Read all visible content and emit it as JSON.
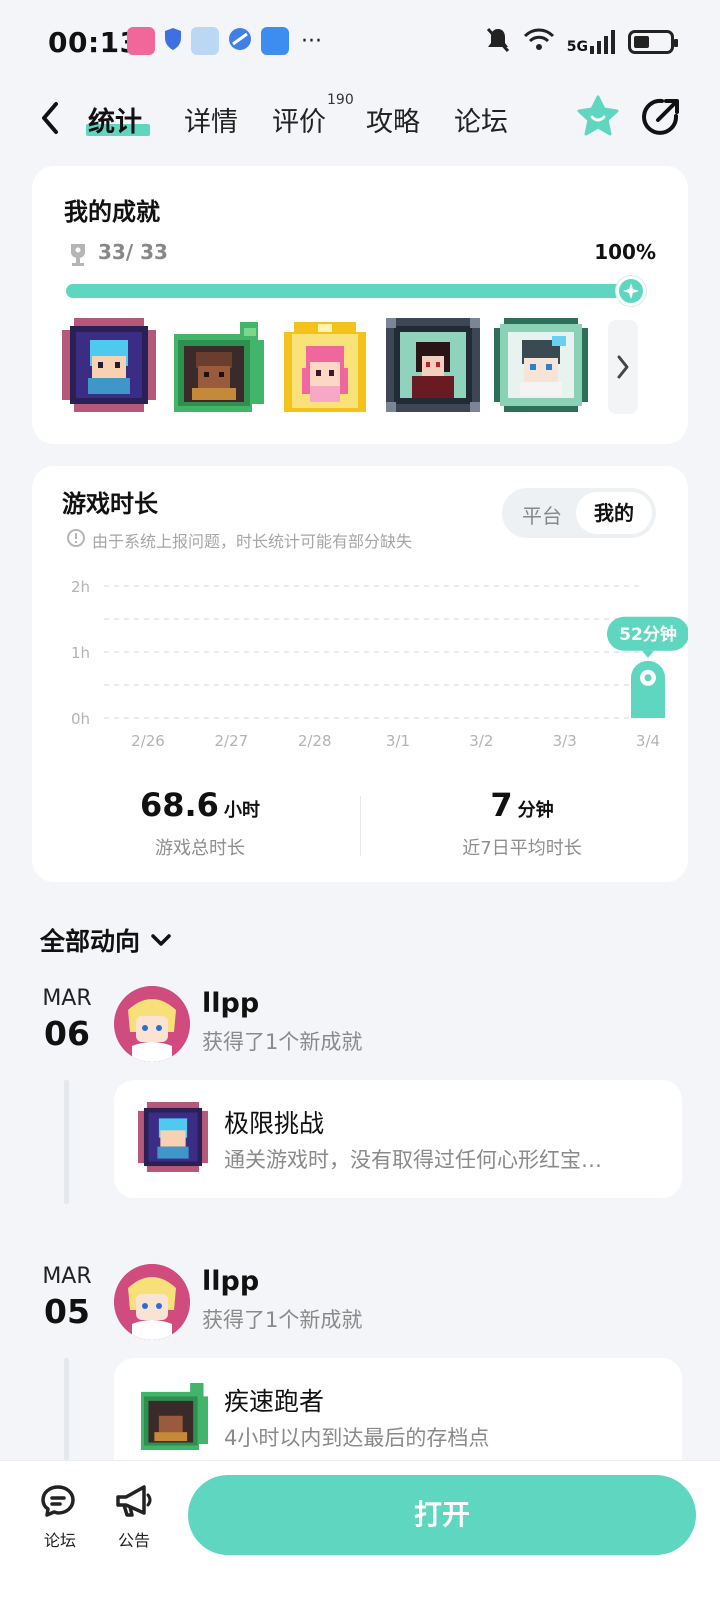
{
  "status_bar": {
    "time": "00:13",
    "network": "5G",
    "battery_level": 0.45
  },
  "tabs": [
    {
      "label": "统计",
      "active": true
    },
    {
      "label": "详情"
    },
    {
      "label": "评价",
      "count": "190"
    },
    {
      "label": "攻略"
    },
    {
      "label": "论坛"
    }
  ],
  "achievements": {
    "title": "我的成就",
    "count": "33/ 33",
    "percent": "100%",
    "progress": 1.0,
    "badges": [
      "badge-1",
      "badge-2",
      "badge-3",
      "badge-4",
      "badge-5"
    ]
  },
  "playtime": {
    "title": "游戏时长",
    "notice": "由于系统上报问题，时长统计可能有部分缺失",
    "toggle": {
      "platform": "平台",
      "mine": "我的",
      "selected": "mine"
    },
    "total_value": "68.6",
    "total_unit": "小时",
    "total_label": "游戏总时长",
    "avg_value": "7",
    "avg_unit": "分钟",
    "avg_label": "近7日平均时长"
  },
  "chart_data": {
    "type": "bar",
    "categories": [
      "2/26",
      "2/27",
      "2/28",
      "3/1",
      "3/2",
      "3/3",
      "3/4"
    ],
    "values": [
      0,
      0,
      0,
      0,
      0,
      0,
      52
    ],
    "unit": "minutes",
    "y_ticks": [
      "0h",
      "1h",
      "2h"
    ],
    "ylim": [
      0,
      120
    ],
    "highlight_label": "52分钟",
    "accent": "#5fd6c0"
  },
  "activity": {
    "header": "全部动向",
    "entries": [
      {
        "month": "MAR",
        "day": "06",
        "user": "llpp",
        "action": "获得了1个新成就",
        "achievement_title": "极限挑战",
        "achievement_desc": "通关游戏时，没有取得过任何心形红宝…"
      },
      {
        "month": "MAR",
        "day": "05",
        "user": "llpp",
        "action": "获得了1个新成就",
        "achievement_title": "疾速跑者",
        "achievement_desc": "4小时以内到达最后的存档点"
      }
    ]
  },
  "bottom_bar": {
    "forum": "论坛",
    "notice": "公告",
    "open": "打开"
  },
  "colors": {
    "accent": "#5fd6c0",
    "background": "#f3f5f8"
  }
}
